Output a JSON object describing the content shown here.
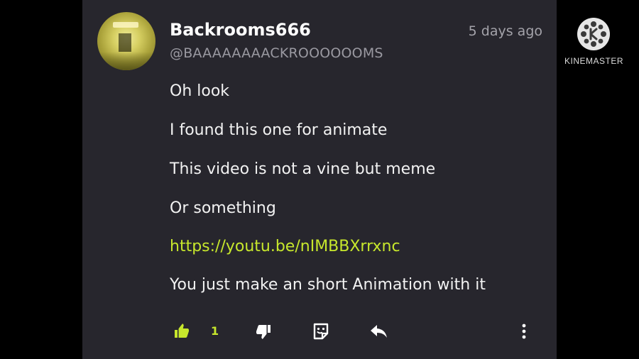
{
  "comment": {
    "username": "Backrooms666",
    "handle": "@BAAAAAAAACKROOOOOOMS",
    "time": "5 days ago",
    "lines": [
      "Oh look",
      "I found this one for animate",
      "This video is not a vine but meme",
      "Or something",
      "https://youtu.be/nIMBBXrrxnc",
      "You just make an short Animation with it"
    ],
    "like_count": "1",
    "accent_color": "#c7e72c"
  },
  "actions": {
    "like_icon": "thumbs-up-icon",
    "dislike_icon": "thumbs-down-icon",
    "reply_sticker_icon": "sticker-reply-icon",
    "reply_icon": "reply-arrow-icon",
    "more_icon": "more-vertical-icon"
  },
  "watermark": {
    "text": "KINEMASTER"
  }
}
